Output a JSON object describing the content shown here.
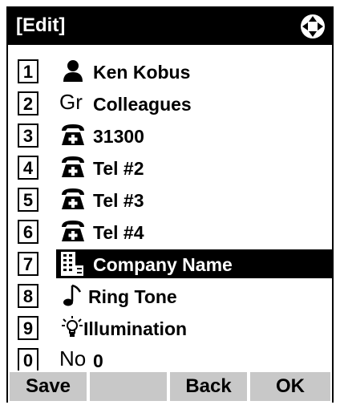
{
  "title": "[Edit]",
  "items": [
    {
      "num": "1",
      "icon": "person-icon",
      "label": "Ken Kobus"
    },
    {
      "num": "2",
      "icon": "group-icon",
      "icon_text": "Gr",
      "label": "Colleagues"
    },
    {
      "num": "3",
      "icon": "telephone-plus-icon",
      "label": "31300"
    },
    {
      "num": "4",
      "icon": "telephone-plus-icon",
      "label": "Tel #2"
    },
    {
      "num": "5",
      "icon": "telephone-plus-icon",
      "label": "Tel #3"
    },
    {
      "num": "6",
      "icon": "telephone-plus-icon",
      "label": "Tel #4"
    },
    {
      "num": "7",
      "icon": "company-building-icon",
      "label": "Company Name",
      "selected": true
    },
    {
      "num": "8",
      "icon": "music-note-icon",
      "label": "Ring Tone"
    },
    {
      "num": "9",
      "icon": "light-bulb-icon",
      "label": "Illumination"
    },
    {
      "num": "0",
      "icon": "number-icon",
      "icon_text": "No",
      "label": "0"
    }
  ],
  "softkeys": [
    "Save",
    "",
    "Back",
    "OK"
  ],
  "colors": {
    "titlebar": "#000000",
    "selection": "#000000",
    "softkey": "#c8c8c8"
  }
}
